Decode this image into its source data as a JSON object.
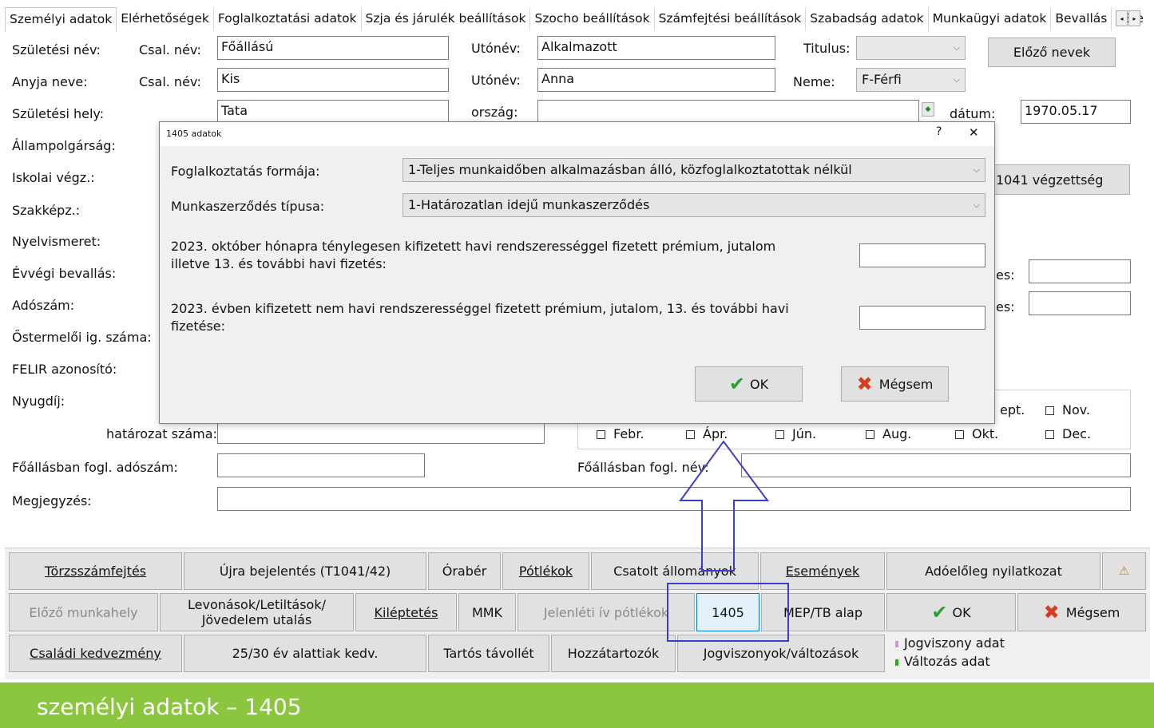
{
  "tabs": {
    "items": [
      "Személyi adatok",
      "Elérhetőségek",
      "Foglalkoztatási adatok",
      "Szja és járulék beállítások",
      "Szocho beállítások",
      "Számfejtési beállítások",
      "Szabadság adatok",
      "Munkaügyi adatok",
      "Bevallás",
      "TB e"
    ],
    "prev": "◂",
    "next": "▸"
  },
  "form": {
    "birth_name_label": "Születési név:",
    "family_name_label": "Csal. név:",
    "birth_family_value": "Főállású",
    "given_name_label": "Utónév:",
    "birth_given_value": "Alkalmazott",
    "title_label": "Titulus:",
    "title_value": "",
    "previous_names_button": "Előző nevek",
    "mother_name_label": "Anyja neve:",
    "mother_family_value": "Kis",
    "mother_given_value": "Anna",
    "gender_label": "Neme:",
    "gender_value": "F-Férfi",
    "birth_place_label": "Születési hely:",
    "birth_place_value": "Tata",
    "country_label": "ország:",
    "country_value": "",
    "date_label": "dátum:",
    "date_value": "1970.05.17",
    "citizenship_label": "Állampolgárság:",
    "school_label": "Iskolai végz.:",
    "t1041_button": "1041 végzettség",
    "vocational_label": "Szakképz.:",
    "language_label": "Nyelvismeret:",
    "yearend_label": "Évvégi bevallás:",
    "yearend_right_suffix": "es:",
    "tax_number_label": "Adószám:",
    "tax_right_suffix": "es:",
    "producer_label": "Őstermelői ig. száma:",
    "felir_label": "FELIR azonosító:",
    "pension_label": "Nyugdíj:",
    "resolution_label": "határozat száma:",
    "resolution_value": "",
    "main_tax_label": "Főállásban fogl. adószám:",
    "main_tax_value": "",
    "main_name_label": "Főállásban fogl. név:",
    "main_name_value": "",
    "note_label": "Megjegyzés:",
    "note_value": ""
  },
  "months": {
    "row1": [
      "ept.",
      "Nov."
    ],
    "row2": [
      "Febr.",
      "Ápr.",
      "Jún.",
      "Aug.",
      "Okt.",
      "Dec."
    ]
  },
  "dialog": {
    "title": "1405 adatok",
    "help": "?",
    "close": "✕",
    "employment_form_label": "Foglalkoztatás formája:",
    "employment_form_value": "1-Teljes munkaidőben alkalmazásban álló, közfoglalkoztatottak nélkül",
    "contract_type_label": "Munkaszerződés típusa:",
    "contract_type_value": "1-Határozatlan idejű munkaszerződés",
    "q1_line1": "2023. október hónapra ténylegesen kifizetett havi rendszerességgel fizetett prémium, jutalom",
    "q1_line2": "illetve 13. és további havi fizetés:",
    "q1_value": "",
    "q2_line1": "2023. évben kifizetett nem havi rendszerességgel fizetett prémium, jutalom, 13. és további havi",
    "q2_line2": "fizetése:",
    "q2_value": "",
    "ok": "OK",
    "cancel": "Mégsem"
  },
  "buttons": {
    "row1": [
      "Törzsszámfejtés",
      "Újra bejelentés (T1041/42)",
      "Órabér",
      "Pótlékok",
      "Csatolt állományok",
      "Események",
      "Adóelőleg nyilatkozat"
    ],
    "row2": [
      "Előző munkahely",
      "Levonások/Letiltások/",
      "Jövedelem utalás",
      "Kiléptetés",
      "MMK",
      "Jelenléti ív pótlékok",
      "1405",
      "MEP/TB alap",
      "OK",
      "Mégsem"
    ],
    "row3": [
      "Családi kedvezmény",
      "25/30 év alattiak kedv.",
      "Tartós távollét",
      "Hozzátartozók",
      "Jogviszonyok/változások"
    ]
  },
  "legend": {
    "legal_relation": "Jogviszony adat",
    "change": "Változás adat",
    "legal_color": "#c89ad8",
    "change_color": "#22b022"
  },
  "annotation_color": "#3c3cc8",
  "banner": "személyi adatok – 1405"
}
